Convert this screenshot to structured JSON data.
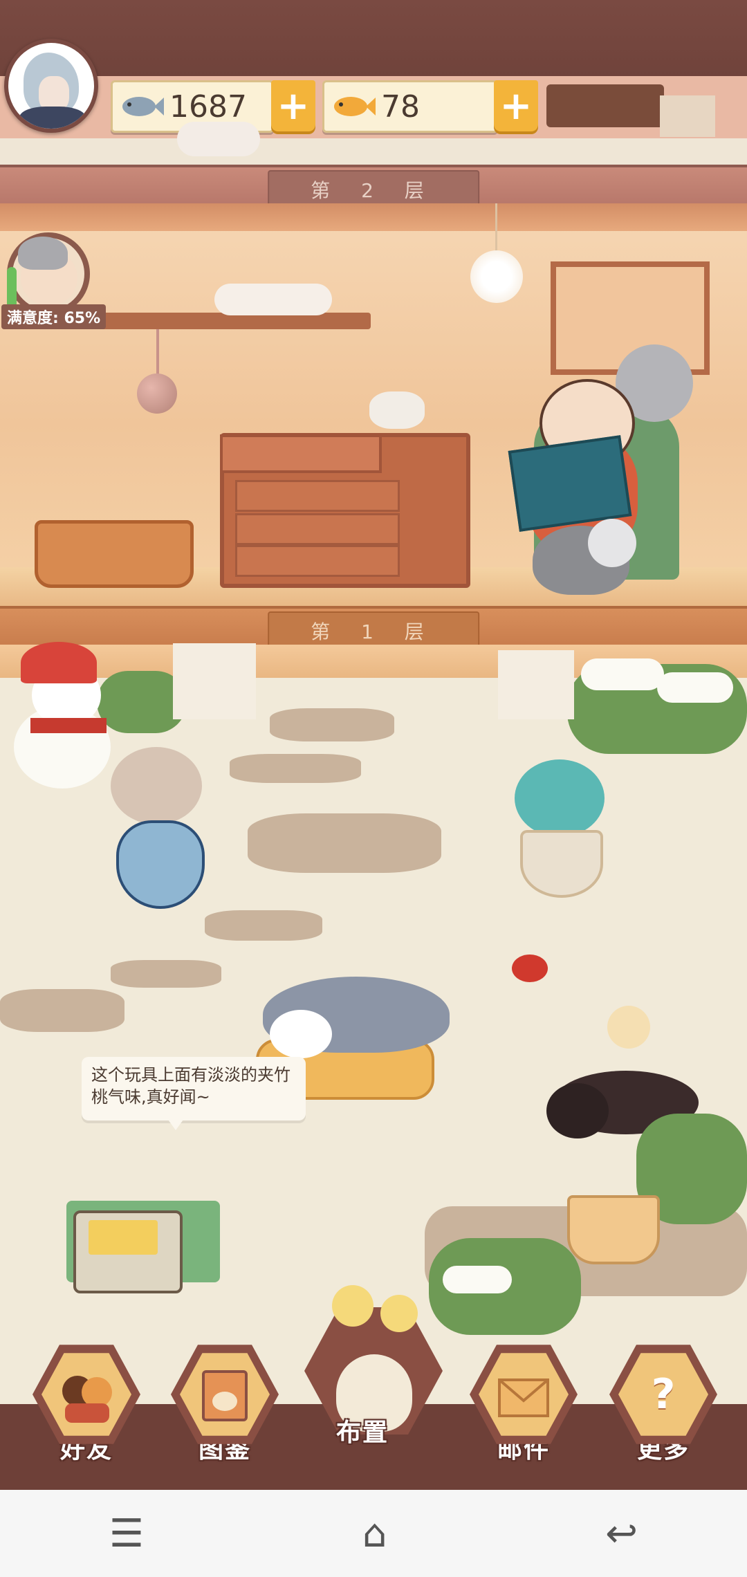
{
  "header": {
    "currencies": [
      {
        "icon": "fish-icon",
        "amount": "1687"
      },
      {
        "icon": "gold-fish-icon",
        "amount": "78"
      }
    ],
    "plus_label": "+"
  },
  "floors": {
    "floor2_label": "第 2 层",
    "floor1_label": "第 1 层"
  },
  "resident": {
    "satisfaction_label": "满意度: 65%"
  },
  "speech_bubble": {
    "text": "这个玩具上面有淡淡的夹竹桃气味,真好闻~"
  },
  "bottom_nav": [
    {
      "label": "好友",
      "icon": "friends-icon"
    },
    {
      "label": "图鉴",
      "icon": "catalog-book-icon"
    },
    {
      "label": "布置",
      "icon": "decorate-vase-icon"
    },
    {
      "label": "邮件",
      "icon": "mail-icon"
    },
    {
      "label": "更多",
      "icon": "more-icon"
    }
  ],
  "more_glyph": "?",
  "system_nav": {
    "menu": "☰",
    "home": "⌂",
    "back": "↩"
  }
}
